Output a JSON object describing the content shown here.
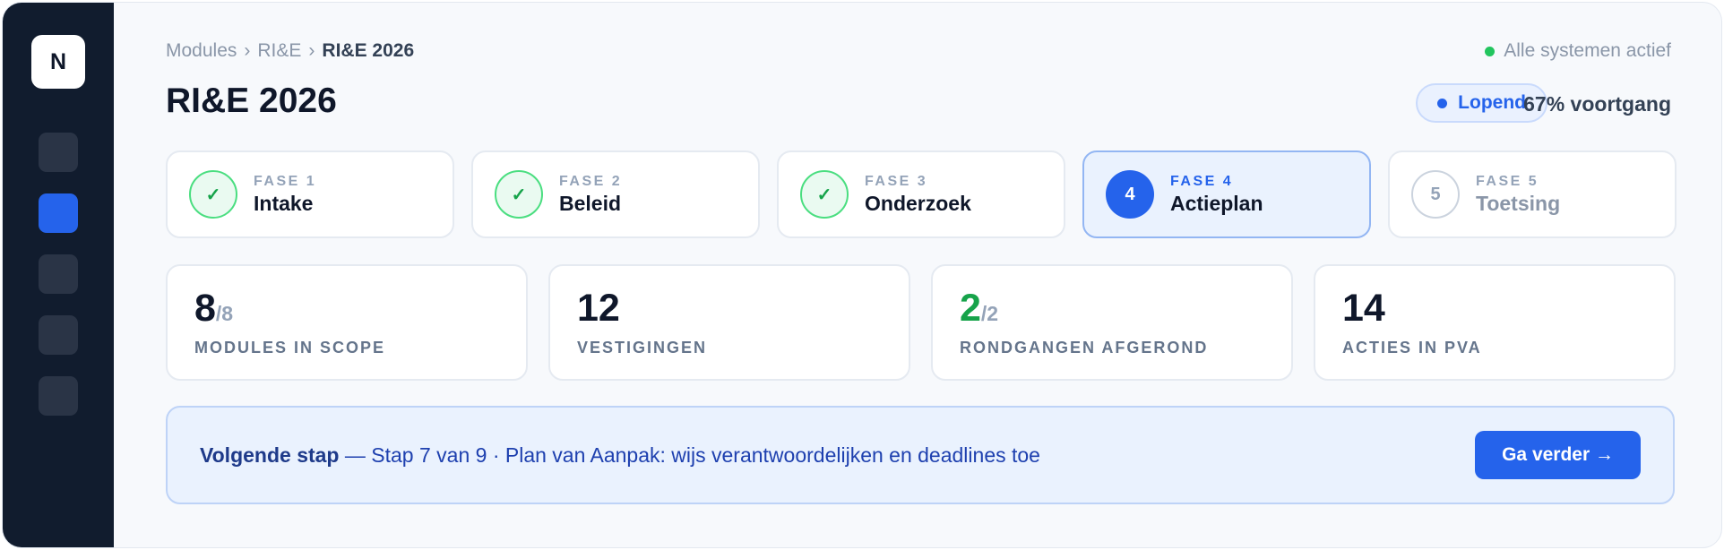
{
  "sidebar": {
    "logo": "N",
    "items": [
      {
        "name": "nav-1",
        "active": false
      },
      {
        "name": "nav-2",
        "active": true
      },
      {
        "name": "nav-3",
        "active": false
      },
      {
        "name": "nav-4",
        "active": false
      },
      {
        "name": "nav-5",
        "active": false
      }
    ]
  },
  "breadcrumb": {
    "items": [
      "Modules",
      "RI&E",
      "RI&E 2026"
    ],
    "separator": "›"
  },
  "system_status": {
    "label": "Alle systemen actief",
    "color": "#22c55e"
  },
  "page_title": "RI&E 2026",
  "status_badge": {
    "label": "Lopend",
    "color": "#2563eb"
  },
  "progress_label": "67% voortgang",
  "phases": [
    {
      "num": "FASE 1",
      "name": "Intake",
      "state": "done",
      "marker": "✓"
    },
    {
      "num": "FASE 2",
      "name": "Beleid",
      "state": "done",
      "marker": "✓"
    },
    {
      "num": "FASE 3",
      "name": "Onderzoek",
      "state": "done",
      "marker": "✓"
    },
    {
      "num": "FASE 4",
      "name": "Actieplan",
      "state": "current",
      "marker": "4"
    },
    {
      "num": "FASE 5",
      "name": "Toetsing",
      "state": "todo",
      "marker": "5"
    }
  ],
  "stats": [
    {
      "value": "8",
      "sub": "/8",
      "label": "MODULES IN SCOPE"
    },
    {
      "value": "12",
      "sub": "",
      "label": "VESTIGINGEN"
    },
    {
      "value": "2",
      "sub": "/2",
      "label": "RONDGANGEN AFGEROND"
    },
    {
      "value": "14",
      "sub": "",
      "label": "ACTIES IN PVA"
    }
  ],
  "next_step": {
    "heading": "Volgende stap",
    "text": " — Stap 7 van 9 · Plan van Aanpak: wijs verantwoordelijken en deadlines toe",
    "button": "Ga verder →"
  },
  "colors": {
    "accent": "#2563eb",
    "success": "#16a34a",
    "sidebar_bg": "#111c2e"
  }
}
